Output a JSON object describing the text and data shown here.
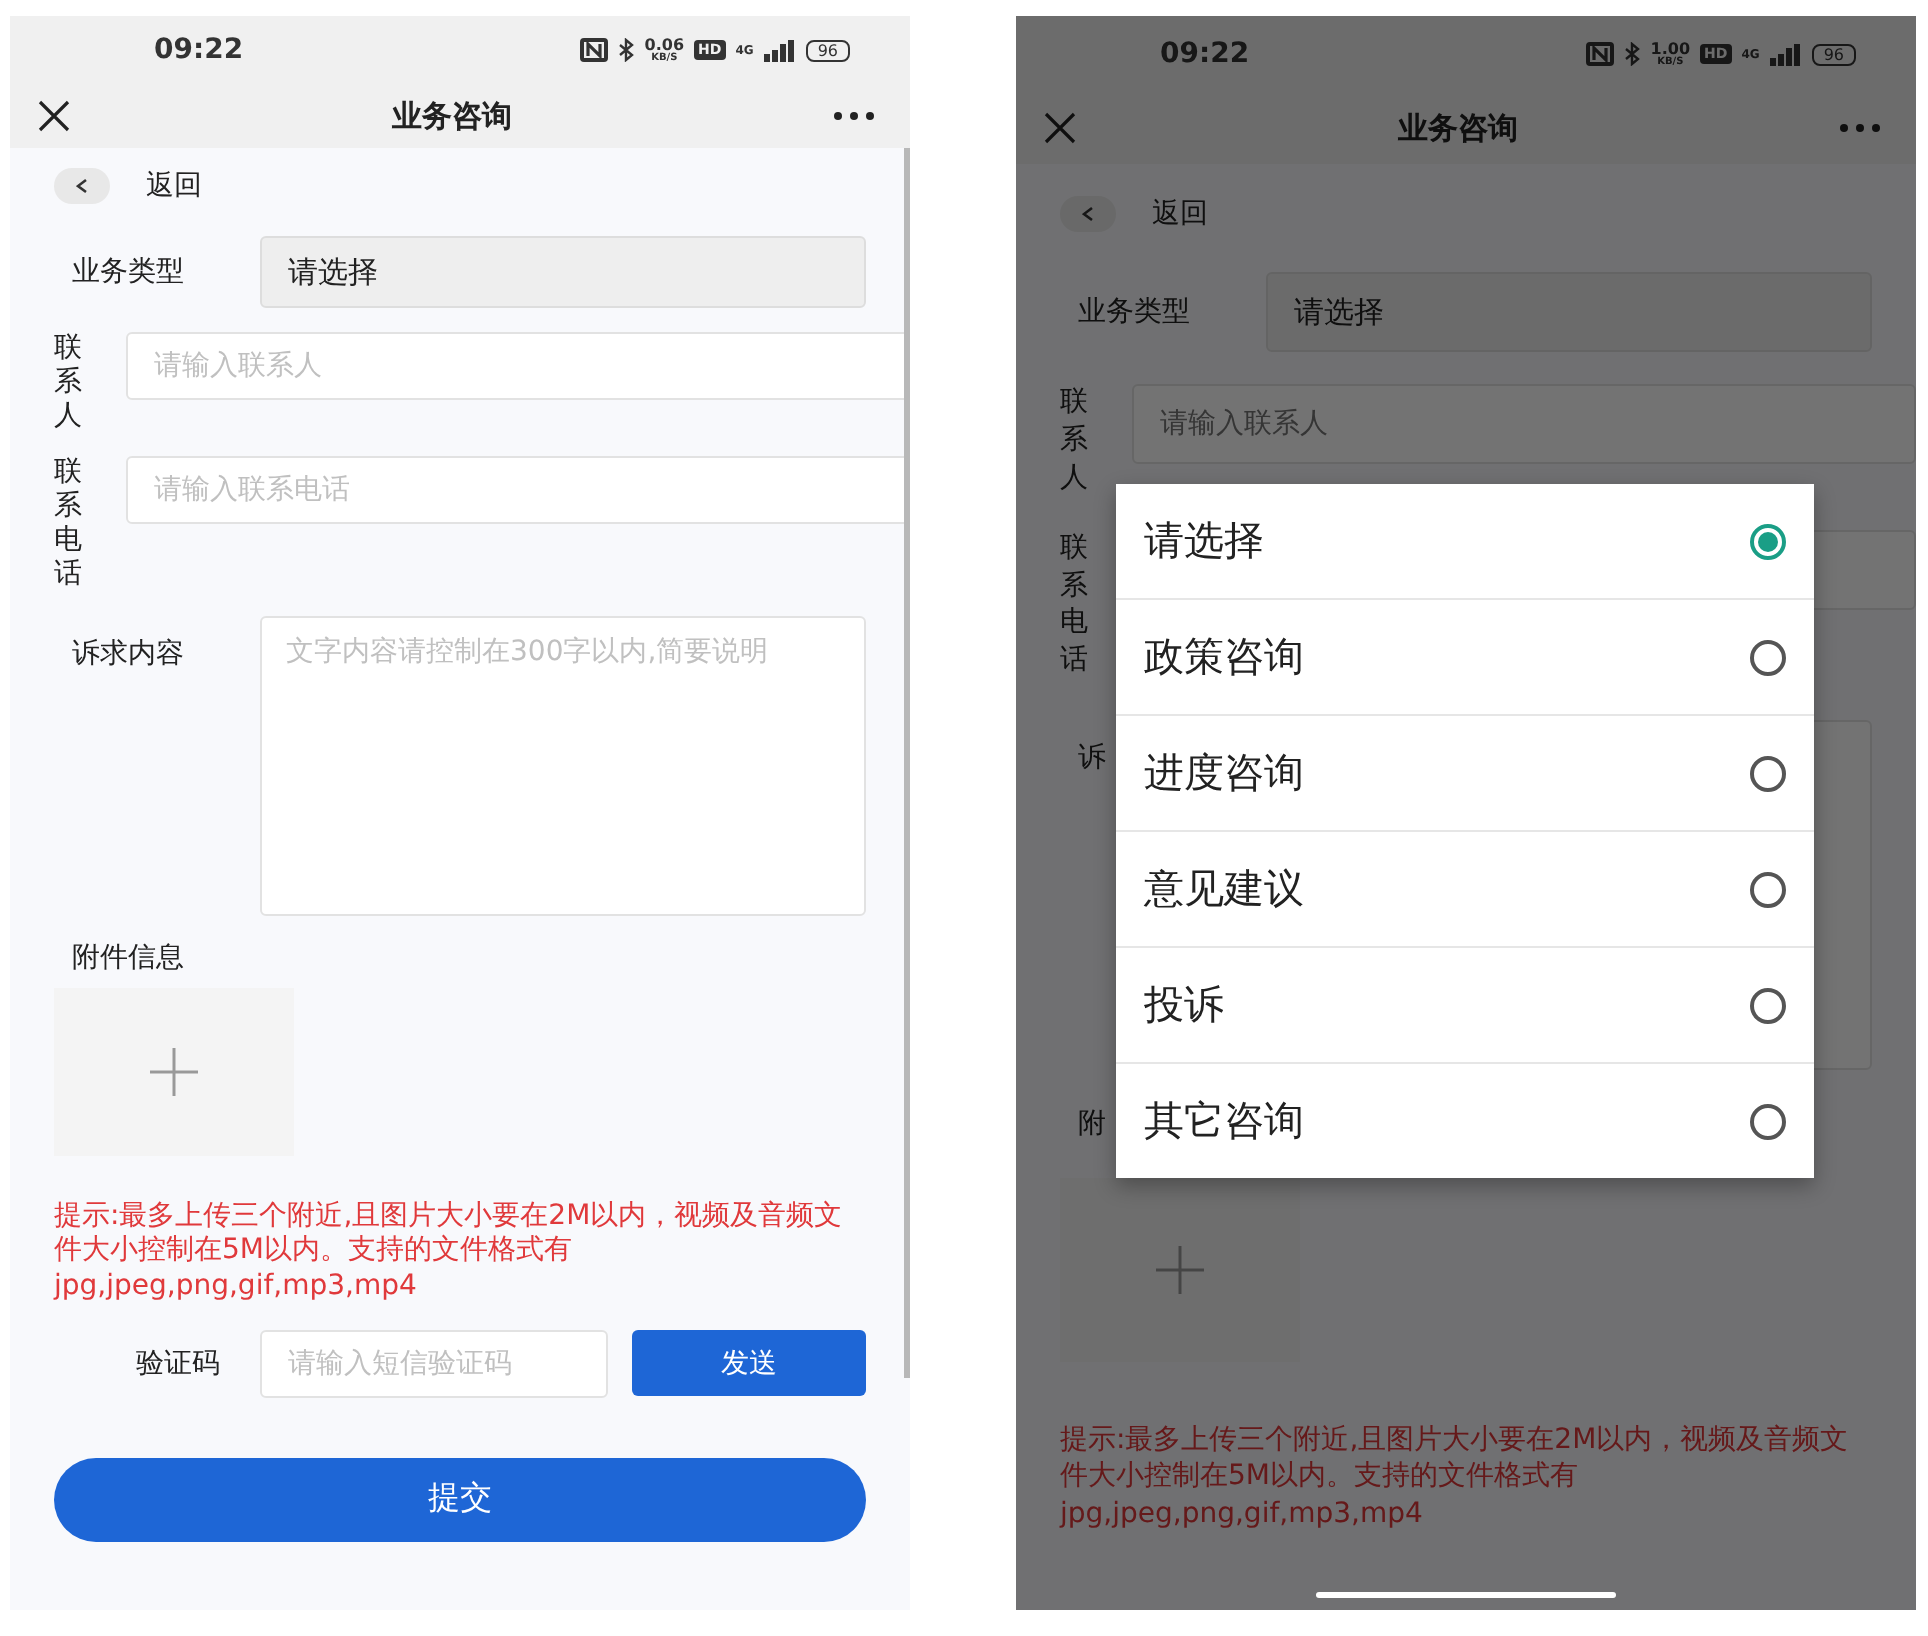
{
  "screens": [
    {
      "dimmed": false,
      "status_bar": {
        "time": "09:22",
        "speed_value": "0.06",
        "speed_unit": "KB/S",
        "hd": "HD",
        "network": "4G",
        "battery": "96"
      },
      "nav": {
        "title": "业务咨询"
      },
      "back": {
        "label": "返回"
      },
      "fields": [
        {
          "kind": "select",
          "label": "业务类型",
          "value": "请选择"
        },
        {
          "kind": "input",
          "label": "联系人",
          "placeholder": "请输入联系人"
        },
        {
          "kind": "input",
          "label": "联系电话",
          "placeholder": "请输入联系电话"
        },
        {
          "kind": "textarea",
          "label": "诉求内容",
          "placeholder": "文字内容请控制在300字以内,简要说明"
        },
        {
          "kind": "upload",
          "label": "附件信息"
        },
        {
          "kind": "hint",
          "text": "提示:最多上传三个附近,且图片大小要在2M以内，视频及音频文件大小控制在5M以内。支持的文件格式有jpg,jpeg,png,gif,mp3,mp4"
        },
        {
          "kind": "code",
          "label": "验证码",
          "placeholder": "请输入短信验证码",
          "button": "发送"
        },
        {
          "kind": "submit",
          "button": "提交"
        }
      ]
    },
    {
      "dimmed": true,
      "status_bar": {
        "time": "09:22",
        "speed_value": "1.00",
        "speed_unit": "KB/S",
        "hd": "HD",
        "network": "4G",
        "battery": "96"
      },
      "nav": {
        "title": "业务咨询"
      },
      "back": {
        "label": "返回"
      },
      "fields": [
        {
          "kind": "select",
          "label": "业务类型",
          "value": "请选择"
        },
        {
          "kind": "input",
          "label": "联系人",
          "placeholder": "请输入联系人"
        },
        {
          "kind": "input",
          "label": "联系电话"
        },
        {
          "kind": "textarea",
          "label": "诉"
        },
        {
          "kind": "upload",
          "label": "附"
        },
        {
          "kind": "hint",
          "text": "提示:最多上传三个附近,且图片大小要在2M以内，视频及音频文件大小控制在5M以内。支持的文件格式有jpg,jpeg,png,gif,mp3,mp4"
        }
      ],
      "picker": {
        "options": [
          {
            "label": "请选择",
            "selected": true
          },
          {
            "label": "政策咨询",
            "selected": false
          },
          {
            "label": "进度咨询",
            "selected": false
          },
          {
            "label": "意见建议",
            "selected": false
          },
          {
            "label": "投诉",
            "selected": false
          },
          {
            "label": "其它咨询",
            "selected": false
          }
        ]
      }
    }
  ]
}
